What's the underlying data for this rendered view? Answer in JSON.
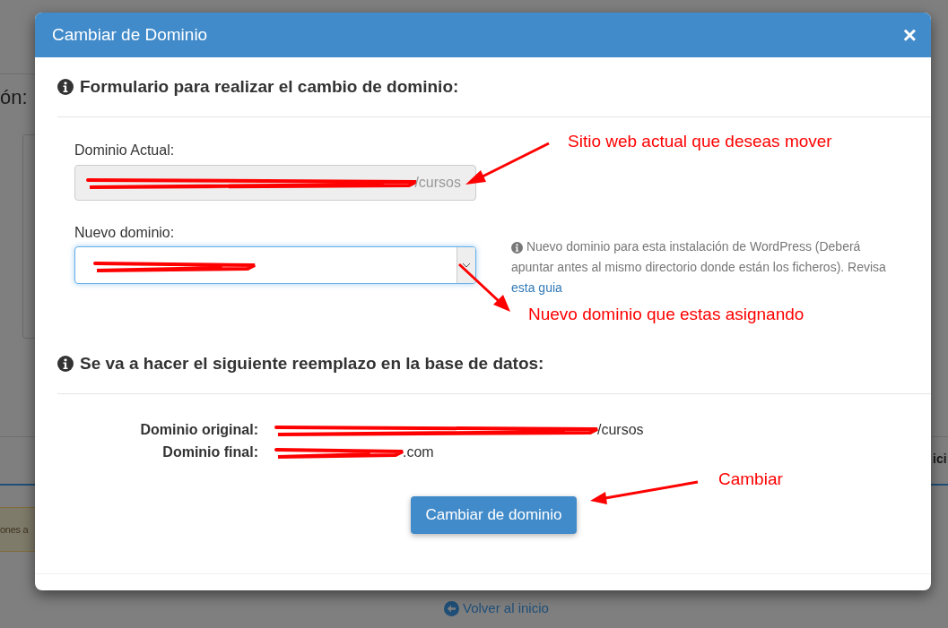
{
  "background": {
    "heading_fragment": "ón:",
    "column_fragment": "ici",
    "alert_fragment": "ones a",
    "back_link": "Volver al inicio"
  },
  "dialog": {
    "title": "Cambiar de Dominio",
    "close": "×",
    "form_heading": "Formulario para realizar el cambio de dominio:",
    "current_domain": {
      "label": "Dominio Actual:",
      "value": "/cursos",
      "disabled": true
    },
    "new_domain": {
      "label": "Nuevo dominio:",
      "focused": true
    },
    "help": {
      "text": "Nuevo dominio para esta instalación de WordPress (Deberá apuntar antes al mismo directorio donde están los ficheros). Revisa",
      "link": "esta guia"
    },
    "replace_heading": "Se va a hacer el siguiente reemplazo en la base de datos:",
    "replacements": [
      {
        "label": "Dominio original:",
        "value": "/cursos"
      },
      {
        "label": "Dominio final:",
        "value": ".com"
      }
    ],
    "button": "Cambiar de dominio"
  },
  "annotations": [
    {
      "text": "Sitio web actual que deseas mover"
    },
    {
      "text": "Nuevo dominio que estas asignando"
    },
    {
      "text": "Cambiar"
    }
  ]
}
